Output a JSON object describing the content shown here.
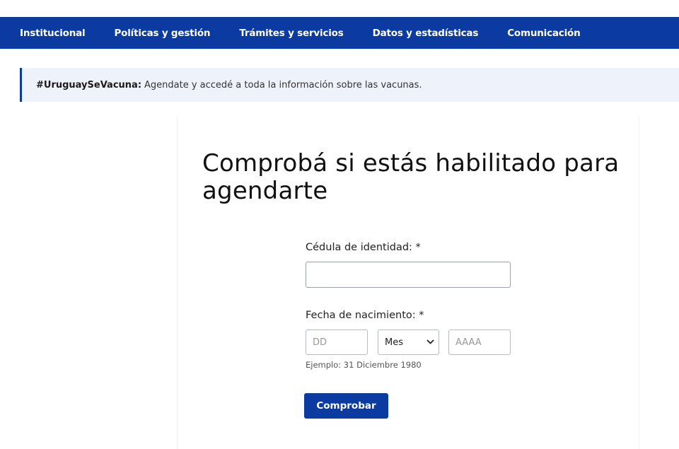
{
  "nav": {
    "items": [
      {
        "label": "Institucional"
      },
      {
        "label": "Políticas y gestión"
      },
      {
        "label": "Trámites y servicios"
      },
      {
        "label": "Datos y estadísticas"
      },
      {
        "label": "Comunicación"
      }
    ]
  },
  "banner": {
    "tag": "#UruguaySeVacuna:",
    "text": "Agendate y accedé a toda la información sobre las vacunas."
  },
  "form": {
    "title": "Comprobá si estás habilitado para agendarte",
    "ci_label": "Cédula de identidad: *",
    "ci_value": "",
    "fecha_label": "Fecha de nacimiento: *",
    "dd_placeholder": "DD",
    "mes_selected": "Mes",
    "aaaa_placeholder": "AAAA",
    "hint": "Ejemplo: 31 Diciembre 1980",
    "submit_label": "Comprobar"
  },
  "colors": {
    "nav_bg": "#0b3aa0",
    "banner_bg": "#eef2fb",
    "button_bg": "#0b3aa0"
  },
  "icons": {
    "select_chevron": "chevron-down-icon"
  }
}
